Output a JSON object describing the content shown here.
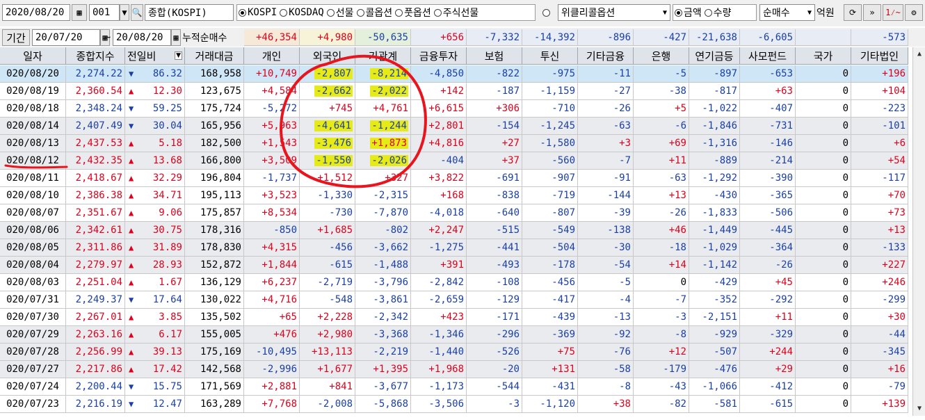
{
  "toolbar": {
    "date": "2020/08/20",
    "code": "001",
    "market_name": "종합(KOSPI)",
    "market_options": [
      "KOSPI",
      "KOSDAQ",
      "선물",
      "콜옵션",
      "풋옵션",
      "주식선물"
    ],
    "weekly_option": "위클리콜옵션",
    "unit_options": [
      "금액",
      "수량"
    ],
    "mode": "순매수",
    "unit_label": "억원",
    "icons": [
      "refresh-icon",
      "double-arrow-icon",
      "chart-icon",
      "settings-icon"
    ]
  },
  "period": {
    "label": "기간",
    "start": "20/07/20",
    "sep": "~",
    "end": "20/08/20",
    "cumulative_label": "누적순매수",
    "sums": [
      "+46,354",
      "+4,980",
      "-50,635",
      "+656",
      "-7,332",
      "-14,392",
      "-896",
      "-427",
      "-21,638",
      "-6,605",
      "",
      "-573"
    ]
  },
  "columns": [
    "일자",
    "종합지수",
    "전일비",
    "거래대금",
    "개인",
    "외국인",
    "기관계",
    "금융투자",
    "보험",
    "투신",
    "기타금융",
    "은행",
    "연기금등",
    "사모펀드",
    "국가",
    "기타법인"
  ],
  "rows": [
    {
      "date": "020/08/20",
      "index": "2,274.22",
      "dir": "down",
      "change": "86.32",
      "amount": "168,958",
      "v": [
        "+10,749",
        "-2,807",
        "-8,214",
        "-4,850",
        "-822",
        "-975",
        "-11",
        "-5",
        "-897",
        "-653",
        "0",
        "+196"
      ]
    },
    {
      "date": "020/08/19",
      "index": "2,360.54",
      "dir": "up",
      "change": "12.30",
      "amount": "123,675",
      "v": [
        "+4,584",
        "-2,662",
        "-2,022",
        "+142",
        "-187",
        "-1,159",
        "-27",
        "-38",
        "-817",
        "+63",
        "0",
        "+104"
      ]
    },
    {
      "date": "020/08/18",
      "index": "2,348.24",
      "dir": "down",
      "change": "59.25",
      "amount": "175,724",
      "v": [
        "-5,272",
        "+745",
        "+4,761",
        "+6,615",
        "+306",
        "-710",
        "-26",
        "+5",
        "-1,022",
        "-407",
        "0",
        "-223"
      ]
    },
    {
      "date": "020/08/14",
      "index": "2,407.49",
      "dir": "down",
      "change": "30.04",
      "amount": "165,956",
      "v": [
        "+5,963",
        "-4,641",
        "-1,244",
        "+2,801",
        "-154",
        "-1,245",
        "-63",
        "-6",
        "-1,846",
        "-731",
        "0",
        "-101"
      ]
    },
    {
      "date": "020/08/13",
      "index": "2,437.53",
      "dir": "up",
      "change": "5.18",
      "amount": "182,500",
      "v": [
        "+1,543",
        "-3,476",
        "+1,873",
        "+4,816",
        "+27",
        "-1,580",
        "+3",
        "+69",
        "-1,316",
        "-146",
        "0",
        "+6"
      ]
    },
    {
      "date": "020/08/12",
      "index": "2,432.35",
      "dir": "up",
      "change": "13.68",
      "amount": "166,800",
      "v": [
        "+3,509",
        "-1,550",
        "-2,026",
        "-404",
        "+37",
        "-560",
        "-7",
        "+11",
        "-889",
        "-214",
        "0",
        "+54"
      ]
    },
    {
      "date": "020/08/11",
      "index": "2,418.67",
      "dir": "up",
      "change": "32.29",
      "amount": "196,804",
      "v": [
        "-1,737",
        "+1,512",
        "+327",
        "+3,822",
        "-691",
        "-907",
        "-91",
        "-63",
        "-1,292",
        "-390",
        "0",
        "-117"
      ]
    },
    {
      "date": "020/08/10",
      "index": "2,386.38",
      "dir": "up",
      "change": "34.71",
      "amount": "195,113",
      "v": [
        "+3,523",
        "-1,330",
        "-2,315",
        "+168",
        "-838",
        "-719",
        "-144",
        "+13",
        "-430",
        "-365",
        "0",
        "+70"
      ]
    },
    {
      "date": "020/08/07",
      "index": "2,351.67",
      "dir": "up",
      "change": "9.06",
      "amount": "175,857",
      "v": [
        "+8,534",
        "-730",
        "-7,870",
        "-4,018",
        "-640",
        "-807",
        "-39",
        "-26",
        "-1,833",
        "-506",
        "0",
        "+73"
      ]
    },
    {
      "date": "020/08/06",
      "index": "2,342.61",
      "dir": "up",
      "change": "30.75",
      "amount": "178,316",
      "v": [
        "-850",
        "+1,685",
        "-802",
        "+2,247",
        "-515",
        "-549",
        "-138",
        "+46",
        "-1,449",
        "-445",
        "0",
        "+13"
      ]
    },
    {
      "date": "020/08/05",
      "index": "2,311.86",
      "dir": "up",
      "change": "31.89",
      "amount": "178,830",
      "v": [
        "+4,315",
        "-456",
        "-3,662",
        "-1,275",
        "-441",
        "-504",
        "-30",
        "-18",
        "-1,029",
        "-364",
        "0",
        "-133"
      ]
    },
    {
      "date": "020/08/04",
      "index": "2,279.97",
      "dir": "up",
      "change": "28.93",
      "amount": "152,872",
      "v": [
        "+1,844",
        "-615",
        "-1,488",
        "+391",
        "-493",
        "-178",
        "-54",
        "+14",
        "-1,142",
        "-26",
        "0",
        "+227"
      ]
    },
    {
      "date": "020/08/03",
      "index": "2,251.04",
      "dir": "up",
      "change": "1.67",
      "amount": "136,129",
      "v": [
        "+6,237",
        "-2,719",
        "-3,796",
        "-2,842",
        "-108",
        "-456",
        "-5",
        "0",
        "-429",
        "+45",
        "0",
        "+246"
      ]
    },
    {
      "date": "020/07/31",
      "index": "2,249.37",
      "dir": "down",
      "change": "17.64",
      "amount": "130,022",
      "v": [
        "+4,716",
        "-548",
        "-3,861",
        "-2,659",
        "-129",
        "-417",
        "-4",
        "-7",
        "-352",
        "-292",
        "0",
        "-299"
      ]
    },
    {
      "date": "020/07/30",
      "index": "2,267.01",
      "dir": "up",
      "change": "3.85",
      "amount": "135,502",
      "v": [
        "+65",
        "+2,228",
        "-2,342",
        "+423",
        "-171",
        "-439",
        "-13",
        "-3",
        "-2,151",
        "+11",
        "0",
        "+30"
      ]
    },
    {
      "date": "020/07/29",
      "index": "2,263.16",
      "dir": "up",
      "change": "6.17",
      "amount": "155,005",
      "v": [
        "+476",
        "+2,980",
        "-3,368",
        "-1,346",
        "-296",
        "-369",
        "-92",
        "-8",
        "-929",
        "-329",
        "0",
        "-44"
      ]
    },
    {
      "date": "020/07/28",
      "index": "2,256.99",
      "dir": "up",
      "change": "39.13",
      "amount": "175,169",
      "v": [
        "-10,495",
        "+13,113",
        "-2,219",
        "-1,440",
        "-526",
        "+75",
        "-76",
        "+12",
        "-507",
        "+244",
        "0",
        "-345"
      ]
    },
    {
      "date": "020/07/27",
      "index": "2,217.86",
      "dir": "up",
      "change": "17.42",
      "amount": "142,568",
      "v": [
        "-2,996",
        "+1,677",
        "+1,395",
        "+1,968",
        "-20",
        "+131",
        "-58",
        "-179",
        "-476",
        "+29",
        "0",
        "+16"
      ]
    },
    {
      "date": "020/07/24",
      "index": "2,200.44",
      "dir": "down",
      "change": "15.75",
      "amount": "171,569",
      "v": [
        "+2,881",
        "+841",
        "-3,677",
        "-1,173",
        "-544",
        "-431",
        "-8",
        "-43",
        "-1,066",
        "-412",
        "0",
        "-79"
      ]
    },
    {
      "date": "020/07/23",
      "index": "2,216.19",
      "dir": "down",
      "change": "12.47",
      "amount": "163,289",
      "v": [
        "+7,768",
        "-2,008",
        "-5,868",
        "-3,506",
        "-3",
        "-1,120",
        "+38",
        "-82",
        "-581",
        "-615",
        "0",
        "+139"
      ]
    }
  ],
  "highlighted_rows": [
    0,
    1,
    3,
    4,
    5
  ],
  "colors": {
    "up": "#e0001b",
    "down": "#1a3fa6",
    "highlight": "#e6ea16",
    "annotation": "#e8141e",
    "selected_row": "#cfe6f7"
  }
}
